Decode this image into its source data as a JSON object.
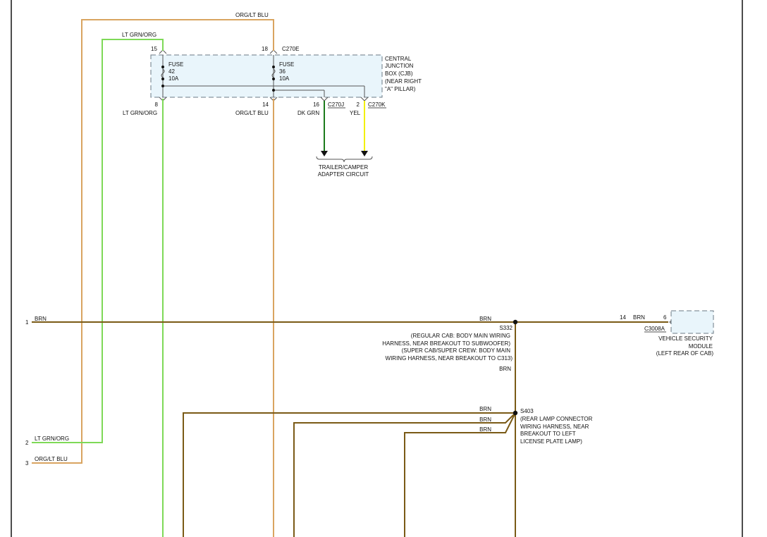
{
  "colors": {
    "brn": "#7a5a16",
    "org_lt_blu": "#d9a460",
    "lt_grn_org": "#7ed957",
    "dk_grn": "#1c7a1c",
    "yel": "#f2f000",
    "box_fill": "#e9f5fb",
    "frame": "#111111"
  },
  "top": {
    "org_lt_blu_label": "ORG/LT BLU",
    "lt_grn_org_label": "LT GRN/ORG"
  },
  "cjb": {
    "pin_15": "15",
    "pin_18": "18",
    "connector_top": "C270E",
    "fuse_a": {
      "label": "FUSE",
      "number": "42",
      "rating": "10A"
    },
    "fuse_b": {
      "label": "FUSE",
      "number": "36",
      "rating": "10A"
    },
    "name_lines": [
      "CENTRAL",
      "JUNCTION",
      "BOX (CJB)",
      "(NEAR RIGHT",
      "\"A\" PILLAR)"
    ],
    "pin_8": "8",
    "pin_14": "14",
    "pin_16": "16",
    "pin_2": "2",
    "wire_lt_grn_org": "LT GRN/ORG",
    "wire_org_lt_blu": "ORG/LT BLU",
    "wire_dk_grn": "DK GRN",
    "wire_yel": "YEL",
    "connector_j": "C270J",
    "connector_k": "C270K"
  },
  "trailer": {
    "lines": [
      "TRAILER/CAMPER",
      "ADAPTER CIRCUIT"
    ]
  },
  "left": {
    "pin_1": "1",
    "pin_1_wire": "BRN",
    "pin_2": "2",
    "pin_2_wire": "LT GRN/ORG",
    "pin_3": "3",
    "pin_3_wire": "ORG/LT BLU"
  },
  "s332": {
    "wire_in": "BRN",
    "name": "S332",
    "desc_lines": [
      "(REGULAR CAB: BODY MAIN WIRING",
      "HARNESS, NEAR BREAKOUT TO SUBWOOFER)",
      "(SUPER CAB/SUPER CREW: BODY MAIN",
      "WIRING HARNESS, NEAR BREAKOUT TO C313)"
    ],
    "wire_down": "BRN"
  },
  "vsm": {
    "pin_14": "14",
    "wire": "BRN",
    "pin_6": "6",
    "connector": "C3008A",
    "lines": [
      "VEHICLE SECURITY",
      "MODULE",
      "(LEFT REAR OF CAB)"
    ]
  },
  "s403": {
    "name": "S403",
    "desc_lines": [
      "(REAR LAMP CONNECTOR",
      "WIRING HARNESS, NEAR",
      "BREAKOUT TO LEFT",
      "LICENSE PLATE LAMP)"
    ],
    "wire_1": "BRN",
    "wire_2": "BRN",
    "wire_3": "BRN"
  }
}
